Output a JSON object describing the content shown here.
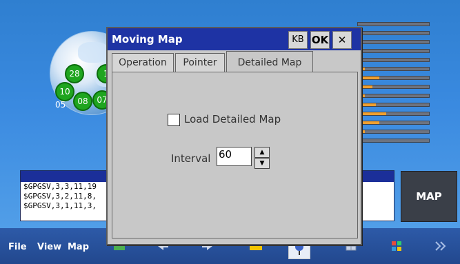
{
  "background": {
    "accent": "#2f7fd0"
  },
  "satellites": [
    {
      "id": "28"
    },
    {
      "id": "1"
    },
    {
      "id": "10"
    },
    {
      "id": "08"
    },
    {
      "id": "07"
    }
  ],
  "globe_label": "05",
  "signal_bars": [
    0,
    0,
    0,
    0,
    0,
    0.1,
    0.3,
    0.2,
    0.1,
    0.25,
    0.4,
    0.3,
    0.1,
    0.05
  ],
  "nmea": {
    "lines": [
      "$GPGSV,3,3,11,19",
      "$GPGSV,3,2,11,8,",
      "$GPGSV,3,1,11,3,"
    ]
  },
  "map_button": {
    "label": "MAP"
  },
  "taskbar": {
    "file": "File",
    "view": "View",
    "map": "Map"
  },
  "dialog": {
    "title": "Moving Map",
    "kb_label": "KB",
    "ok_label": "OK",
    "close_label": "✕",
    "tabs": [
      {
        "label": "Operation",
        "active": false
      },
      {
        "label": "Pointer",
        "active": false
      },
      {
        "label": "Detailed Map",
        "active": true
      }
    ],
    "load_detailed_map": {
      "label": "Load Detailed Map",
      "checked": false
    },
    "interval": {
      "label": "Interval",
      "value": "60"
    }
  }
}
